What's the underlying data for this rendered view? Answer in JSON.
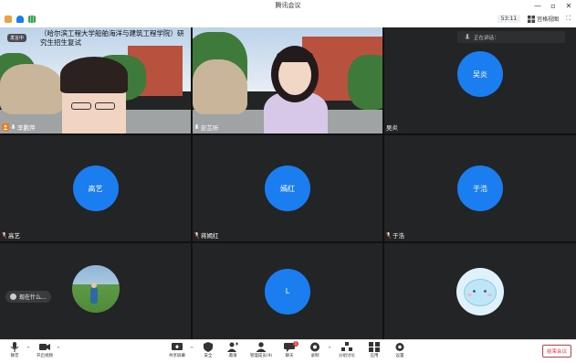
{
  "window": {
    "title": "腾讯会议",
    "controls": [
      "—",
      "▫",
      "✕"
    ]
  },
  "header": {
    "timer": "53:11",
    "view_label": "宫格视图"
  },
  "tiles": [
    {
      "name": "李鹏萍",
      "type": "video",
      "host": true,
      "overlay_title": "（哈尔滨工程大学船舶海洋与建筑工程学院）研究生招生复试",
      "talk_badge": "发言中"
    },
    {
      "name": "彭芷昕",
      "type": "video"
    },
    {
      "name": "吴炎",
      "type": "avatar",
      "avatar_text": "吴炎",
      "speaking_label": "正在讲话："
    },
    {
      "name": "高艺",
      "type": "avatar",
      "avatar_text": "高艺"
    },
    {
      "name": "蒋嫣红",
      "type": "avatar",
      "avatar_text": "嫣红"
    },
    {
      "name": "于浩",
      "type": "avatar",
      "avatar_text": "于浩"
    },
    {
      "name": "",
      "type": "photo",
      "chat_text": "现在什么..."
    },
    {
      "name": "",
      "type": "avatar",
      "avatar_text": "L"
    },
    {
      "name": "",
      "type": "photo"
    }
  ],
  "toolbar": {
    "left": [
      {
        "label": "静音",
        "icon": "microphone-icon"
      },
      {
        "label": "开启视频",
        "icon": "video-camera-icon"
      }
    ],
    "center": [
      {
        "label": "共享屏幕",
        "icon": "share-screen-icon"
      },
      {
        "label": "安全",
        "icon": "shield-icon"
      },
      {
        "label": "邀请",
        "icon": "invite-icon"
      },
      {
        "label": "管理成员(9)",
        "icon": "members-icon"
      },
      {
        "label": "聊天",
        "icon": "chat-icon"
      },
      {
        "label": "录制",
        "icon": "record-icon"
      },
      {
        "label": "分组讨论",
        "icon": "breakout-icon"
      },
      {
        "label": "应用",
        "icon": "apps-icon"
      },
      {
        "label": "设置",
        "icon": "gear-icon"
      }
    ],
    "end_label": "结束会议",
    "chat_badge": "1"
  },
  "colors": {
    "accent": "#1a7df0",
    "tile_bg": "#232425",
    "end_red": "#e03b3b",
    "host_orange": "#f07a1a"
  }
}
